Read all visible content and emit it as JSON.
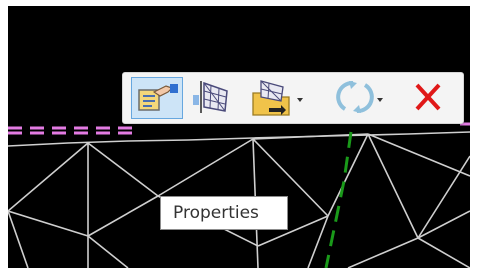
{
  "tooltip": {
    "text": "Properties"
  },
  "toolbar": {
    "buttons": [
      {
        "name": "properties-button",
        "icon": "properties-icon",
        "active": true
      },
      {
        "name": "surface-button",
        "icon": "surface-mesh-icon"
      },
      {
        "name": "export-surface-button",
        "icon": "folder-export-icon",
        "has_dropdown": true
      },
      {
        "name": "refresh-button",
        "icon": "refresh-icon",
        "has_dropdown": true
      },
      {
        "name": "delete-button",
        "icon": "close-icon"
      }
    ]
  },
  "colors": {
    "canvas": "#000000",
    "mesh_lines": "#d0d0d0",
    "boundary_dashed": "#e37be3",
    "green_dashed": "#1a9a1a",
    "toolbar_bg": "#f4f4f4",
    "active_button_bg": "#cde4f7",
    "delete_red": "#e01818"
  }
}
